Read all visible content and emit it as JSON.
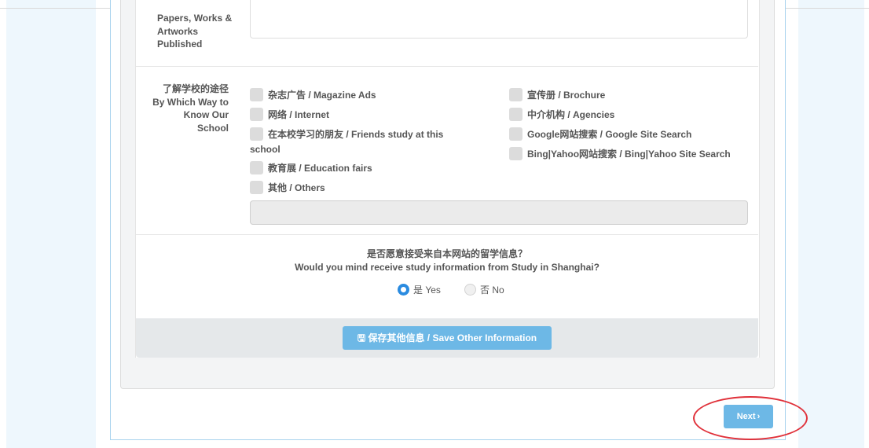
{
  "published": {
    "label_lines": [
      "Papers, Works &",
      "Artworks",
      "Published"
    ]
  },
  "know_school": {
    "label_lines": [
      "了解学校的途径",
      "By Which Way to",
      "Know Our",
      "School"
    ],
    "left_options": [
      "杂志广告 / Magazine Ads",
      "网络 / Internet",
      "在本校学习的朋友 / Friends study at this",
      "school",
      "教育展 / Education fairs",
      "其他 / Others"
    ],
    "right_options": [
      "宣传册 / Brochure",
      "中介机构 / Agencies",
      "Google网站搜索 / Google Site Search",
      "Bing|Yahoo网站搜索 / Bing|Yahoo Site Search"
    ]
  },
  "consent": {
    "question_cn": "是否愿意接受来自本网站的留学信息？",
    "question_en": "Would you mind receive study information from Study in Shanghai?",
    "yes_label": "是 Yes",
    "no_label": "否 No",
    "selected": "yes"
  },
  "save_button": {
    "icon": "save-icon",
    "icon_glyph": "🖫",
    "label": "保存其他信息 / Save Other Information"
  },
  "next_button": {
    "label": "Next",
    "icon": "chevron-right-icon",
    "icon_glyph": "›"
  },
  "colors": {
    "accent": "#6db8e6",
    "radio_on": "#2a8be0",
    "highlight": "#e0313a"
  }
}
